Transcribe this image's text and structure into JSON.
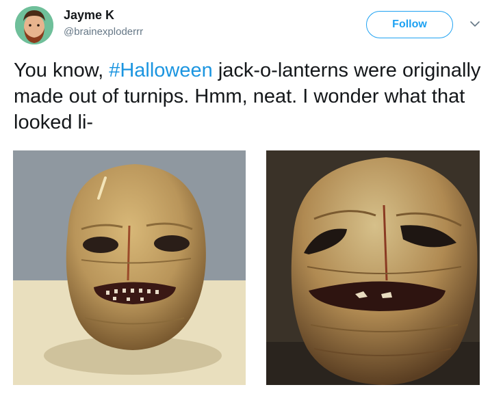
{
  "user": {
    "name": "Jayme K",
    "handle": "@brainexploderrr"
  },
  "actions": {
    "follow_label": "Follow"
  },
  "tweet": {
    "text_before": "You know, ",
    "hashtag": "#Halloween",
    "text_after": " jack-o-lanterns were originally made out of turnips. Hmm, neat. I wonder what that looked li-"
  },
  "colors": {
    "accent": "#1da1f2",
    "hashtag": "#1b95e0",
    "handle_gray": "#657786",
    "text": "#14171a"
  },
  "icons": {
    "menu": "chevron-down-icon"
  }
}
